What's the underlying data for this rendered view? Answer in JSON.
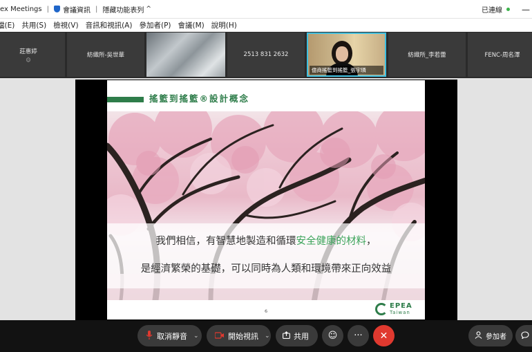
{
  "titlebar": {
    "app_title": "ex Meetings",
    "sep": "|",
    "meeting_info": "會議資訊",
    "hidden_features": "隱藏功能表列",
    "hidden_features_caret": "^",
    "connected": "已連線",
    "minimize": "—"
  },
  "menubar": {
    "items": [
      "檔(E)",
      "共用(S)",
      "檢視(V)",
      "音訊和視訊(A)",
      "參加者(P)",
      "會議(M)",
      "說明(H)"
    ]
  },
  "participants": [
    {
      "name": "莊惠婷",
      "sub": "☺"
    },
    {
      "name": "紡織所-吳世華"
    },
    {
      "name": ""
    },
    {
      "name": "2513 831 2632"
    },
    {
      "name": "億商搖籃到搖籃_張宇璘",
      "speaking": true
    },
    {
      "name": "紡織所_李若蕾"
    },
    {
      "name": "FENC-周名澤"
    }
  ],
  "slide": {
    "title": "搖籃到搖籃®設計概念",
    "line1_a": "我們相信，有智慧地製造和循環",
    "line1_highlight": "安全健康的材料",
    "line1_b": "，",
    "line2": "是經濟繁榮的基礎，可以同時為人類和環境帶來正向效益",
    "page_number": "6",
    "logo_main": "EPEA",
    "logo_sub": "Taiwan"
  },
  "controls": {
    "mute_label": "取消靜音",
    "video_label": "開始視訊",
    "share_label": "共用",
    "participants_label": "參加者",
    "chevron": "⌄",
    "emoji": "☺",
    "more": "···",
    "end": "✕",
    "chat": "◯"
  },
  "colors": {
    "accent_green": "#2e7d4a",
    "highlight_green": "#3ba35a",
    "end_red": "#e0392f",
    "active_border": "#3dbfe0"
  }
}
